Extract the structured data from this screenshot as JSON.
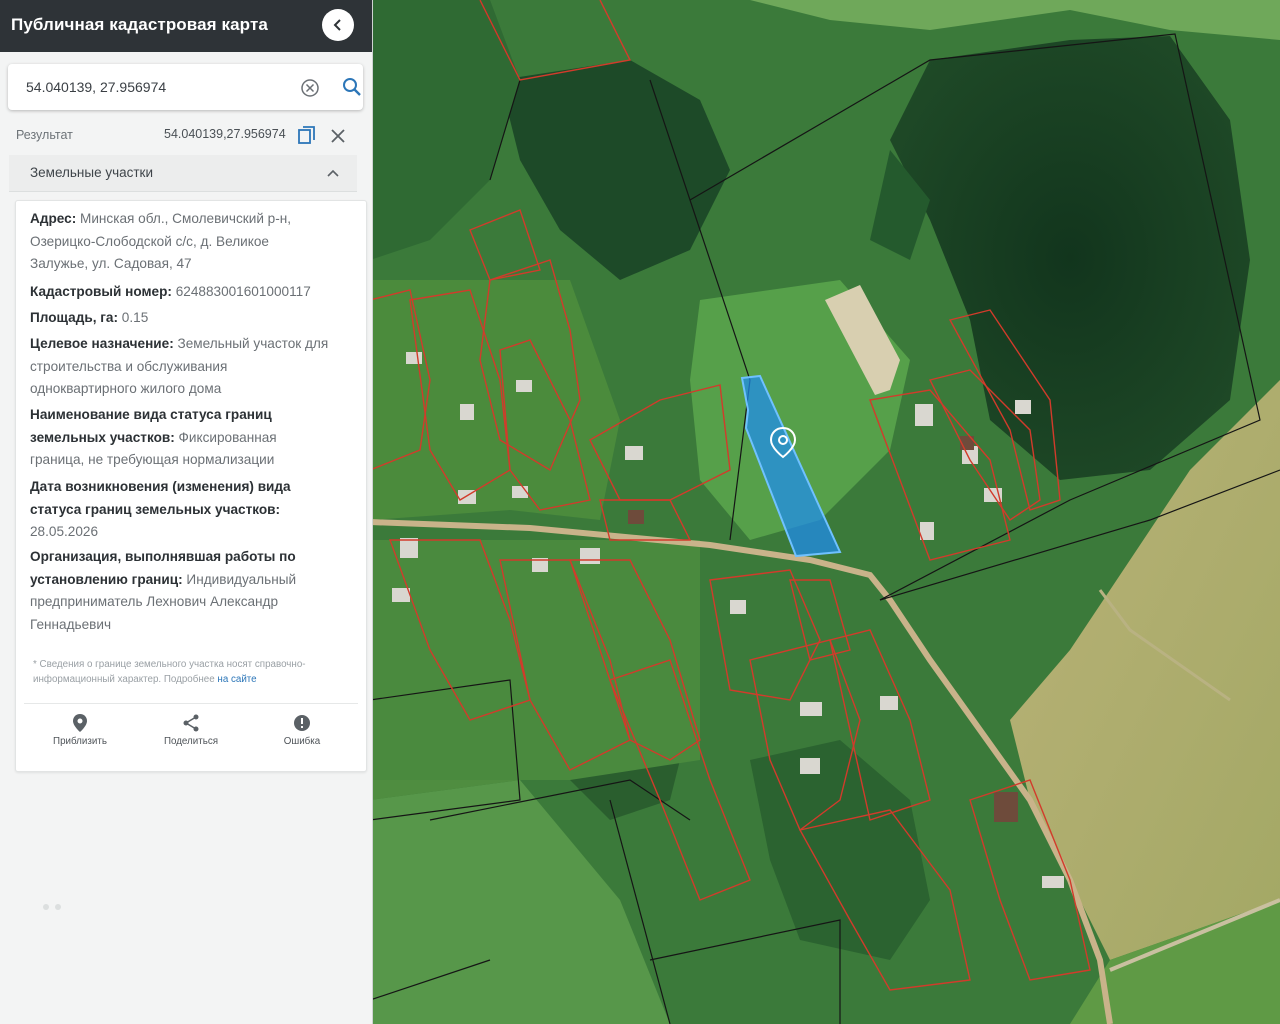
{
  "app": {
    "title": "Публичная кадастровая карта"
  },
  "search": {
    "value": "54.040139, 27.956974"
  },
  "result": {
    "label": "Результат",
    "coords": "54.040139,27.956974"
  },
  "section": {
    "title": "Земельные участки"
  },
  "parcel": {
    "address_label": "Адрес:",
    "address_value": "Минская обл., Смолевичский р-н, Озерицко-Слободской с/с, д. Великое Залужье, ул. Садовая, 47",
    "cadastral_label": "Кадастровый номер:",
    "cadastral_value": "624883001601000117",
    "area_label": "Площадь, га:",
    "area_value": "0.15",
    "purpose_label": "Целевое назначение:",
    "purpose_value": "Земельный участок для строительства и обслуживания одноквартирного жилого дома",
    "boundary_status_label": "Наименование вида статуса границ земельных участков:",
    "boundary_status_value": "Фиксированная граница, не требующая нормализации",
    "status_date_label": "Дата возникновения (изменения) вида статуса границ земельных участков:",
    "status_date_value": "28.05.2026",
    "organization_label": "Организация, выполнявшая работы по установлению границ:",
    "organization_value": "Индивидуальный предприниматель Лехнович Александр Геннадьевич"
  },
  "note": {
    "text": "* Сведения о границе земельного участка носят справочно-информационный характер. Подробнее",
    "link": "на сайте"
  },
  "actions": {
    "zoom": "Приблизить",
    "share": "Поделиться",
    "error": "Ошибка"
  },
  "colors": {
    "topbar": "#2e3337",
    "selected_parcel": "#1f8cf0",
    "parcel_border": "#d23b2b",
    "link": "#2c76b8"
  },
  "icons": [
    "back-chevron-icon",
    "clear-icon",
    "search-icon",
    "copy-icon",
    "close-icon",
    "chevron-up-icon",
    "location-pin-icon",
    "share-icon",
    "error-icon"
  ]
}
